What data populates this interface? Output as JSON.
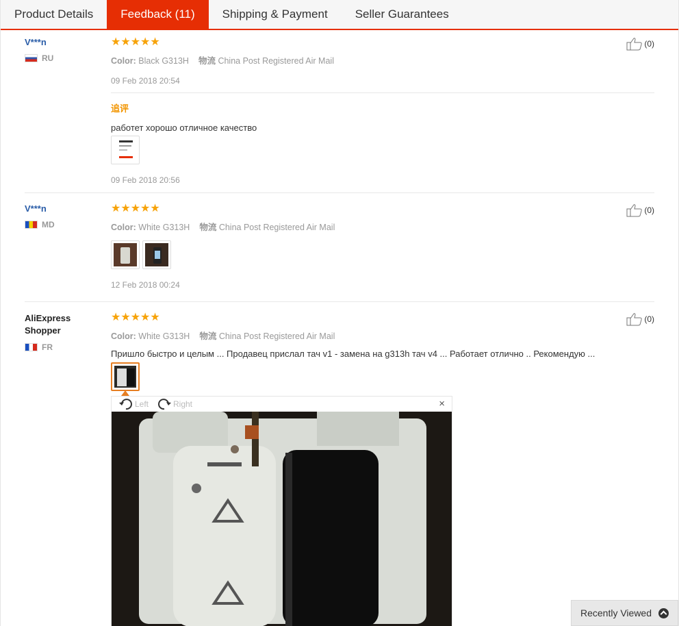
{
  "tabs": [
    {
      "label": "Product Details"
    },
    {
      "label": "Feedback (11)"
    },
    {
      "label": "Shipping & Payment"
    },
    {
      "label": "Seller Guarantees"
    }
  ],
  "reviews": [
    {
      "buyer": "V***n",
      "country": "RU",
      "stars": "★★★★★",
      "color_label": "Color:",
      "color_value": "Black G313H",
      "logistics_label": "物流",
      "logistics_value": "China Post Registered Air Mail",
      "date": "09 Feb 2018 20:54",
      "additional_label": "追评",
      "additional_text": "работет хорошо отличное качество",
      "additional_date": "09 Feb 2018 20:56",
      "likes": "(0)"
    },
    {
      "buyer": "V***n",
      "country": "MD",
      "stars": "★★★★★",
      "color_label": "Color:",
      "color_value": "White G313H",
      "logistics_label": "物流",
      "logistics_value": "China Post Registered Air Mail",
      "date": "12 Feb 2018 00:24",
      "likes": "(0)"
    },
    {
      "buyer_line1": "AliExpress",
      "buyer_line2": "Shopper",
      "country": "FR",
      "stars": "★★★★★",
      "color_label": "Color:",
      "color_value": "White G313H",
      "logistics_label": "物流",
      "logistics_value": "China Post Registered Air Mail",
      "text": "Пришло быстро и целым ... Продавец прислал тач v1 - замена на g313h тач v4 ... Работает отлично .. Рекомендую ...",
      "likes": "(0)"
    }
  ],
  "viewer": {
    "rotate_left": "Left",
    "rotate_right": "Right",
    "close": "×"
  },
  "recently_viewed": "Recently Viewed",
  "colors": {
    "accent": "#e62e04",
    "star": "#f7a30a",
    "buyer_link": "#2a5da8",
    "additional": "#f29500"
  }
}
